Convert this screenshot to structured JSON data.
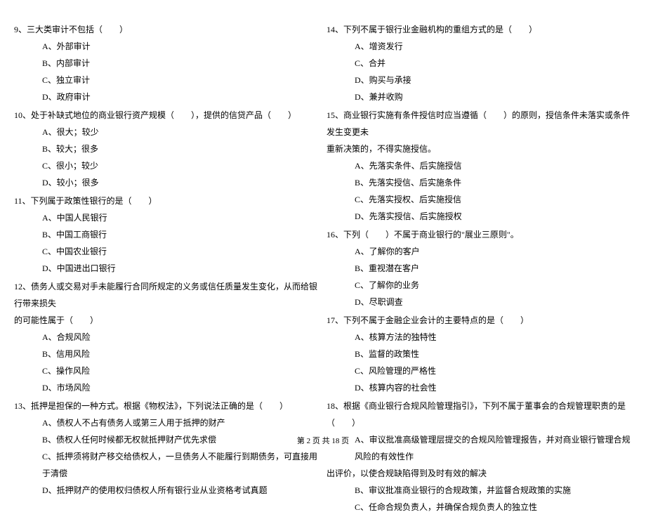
{
  "left": {
    "q9": {
      "stem": "9、三大类审计不包括（　　）",
      "A": "A、外部审计",
      "B": "B、内部审计",
      "C": "C、独立审计",
      "D": "D、政府审计"
    },
    "q10": {
      "stem": "10、处于补缺式地位的商业银行资产规模（　　），提供的信贷产品（　　）",
      "A": "A、很大；较少",
      "B": "B、较大；很多",
      "C": "C、很小；较少",
      "D": "D、较小；很多"
    },
    "q11": {
      "stem": "11、下列属于政策性银行的是（　　）",
      "A": "A、中国人民银行",
      "B": "B、中国工商银行",
      "C": "C、中国农业银行",
      "D": "D、中国进出口银行"
    },
    "q12": {
      "stem_line1": "12、债务人或交易对手未能履行合同所规定的义务或信任质量发生变化，从而给银行带来损失",
      "stem_line2": "的可能性属于（　　）",
      "A": "A、合规风险",
      "B": "B、信用风险",
      "C": "C、操作风险",
      "D": "D、市场风险"
    },
    "q13": {
      "stem": "13、抵押是担保的一种方式。根据《物权法》，下列说法正确的是（　　）",
      "A": "A、债权人不占有债务人或第三人用于抵押的财产",
      "B": "B、债权人任何时候都无权就抵押财产优先求偿",
      "C": "C、抵押须将财产移交给债权人，一旦债务人不能履行到期债务，可直接用于清偿",
      "D": "D、抵押财产的使用权归债权人所有银行业从业资格考试真题"
    }
  },
  "right": {
    "q14": {
      "stem": "14、下列不属于银行业金融机构的重组方式的是（　　）",
      "A": "A、增资发行",
      "C": "C、合并",
      "D": "D、购买与承接",
      "E": "D、兼并收购"
    },
    "q15": {
      "stem_line1": "15、商业银行实施有条件授信时应当遵循（　　）的原则，授信条件未落实或条件发生变更未",
      "stem_line2": "重新决策的，不得实施授信。",
      "A": "A、先落实条件、后实施授信",
      "B": "B、先落实授信、后实施条件",
      "C": "C、先落实授权、后实施授信",
      "D": "D、先落实授信、后实施授权"
    },
    "q16": {
      "stem": "16、下列（　　）不属于商业银行的\"展业三原则\"。",
      "A": "A、了解你的客户",
      "B": "B、重视潜在客户",
      "C": "C、了解你的业务",
      "D": "D、尽职调查"
    },
    "q17": {
      "stem": "17、下列不属于金融企业会计的主要特点的是（　　）",
      "A": "A、核算方法的独特性",
      "B": "B、监督的政策性",
      "C": "C、风险管理的严格性",
      "D": "D、核算内容的社会性"
    },
    "q18": {
      "stem": "18、根据《商业银行合规风险管理指引》，下列不属于董事会的合规管理职责的是（　　）",
      "A_line1": "A、审议批准高级管理层提交的合规风险管理报告，并对商业银行管理合规风险的有效性作",
      "A_line2": "出评价，以使合规缺陷得到及时有效的解决",
      "B": "B、审议批准商业银行的合规政策，并监督合规政策的实施",
      "C": "C、任命合规负责人，并确保合规负责人的独立性"
    }
  },
  "footer": "第 2 页 共 18 页"
}
